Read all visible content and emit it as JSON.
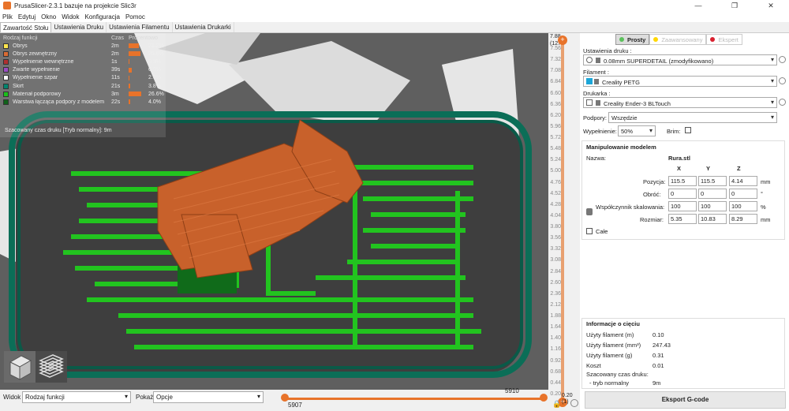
{
  "window": {
    "title": "PrusaSlicer-2.3.1 bazuje na projekcie Slic3r",
    "controls": [
      "—",
      "❐",
      "✕"
    ]
  },
  "menu": [
    "Plik",
    "Edytuj",
    "Okno",
    "Widok",
    "Konfiguracja",
    "Pomoc"
  ],
  "tabs": [
    "Zawartość Stołu",
    "Ustawienia Druku",
    "Ustawienia Filamentu",
    "Ustawienia Drukarki"
  ],
  "legend": {
    "headers": {
      "feature": "Rodzaj funkcji",
      "time": "Czas",
      "percent": "Procentowo"
    },
    "rows": [
      {
        "name": "Obrys",
        "time": "2m",
        "percent": "21.2%",
        "value": 21.2,
        "color": "#ffe64d"
      },
      {
        "name": "Obrys zewnętrzny",
        "time": "2m",
        "percent": "25.6%",
        "value": 25.6,
        "color": "#d96b33"
      },
      {
        "name": "Wypełnienie wewnętrzne",
        "time": "1s",
        "percent": "0.3%",
        "value": 0.3,
        "color": "#b03030"
      },
      {
        "name": "Zwarte wypełnienie",
        "time": "39s",
        "percent": "6.9%",
        "value": 6.9,
        "color": "#9a4dc4"
      },
      {
        "name": "Wypełnienie szpar",
        "time": "11s",
        "percent": "2.0%",
        "value": 2.0,
        "color": "#ffffff"
      },
      {
        "name": "Skirt",
        "time": "21s",
        "percent": "3.8%",
        "value": 3.8,
        "color": "#00856e"
      },
      {
        "name": "Materiał podporowy",
        "time": "3m",
        "percent": "26.6%",
        "value": 26.6,
        "color": "#1ac01a"
      },
      {
        "name": "Warstwa łącząca podpory z modelem",
        "time": "22s",
        "percent": "4.0%",
        "value": 4.0,
        "color": "#10621a"
      }
    ],
    "estimated": "Szacowany czas druku [Tryb normalny]:",
    "estimated_value": "9m"
  },
  "vslider": {
    "top_value": "7.88",
    "top_layer": "(127)",
    "bottom_value": "0.20",
    "bottom_layer": "(1)",
    "ticks": [
      "7.56",
      "7.32",
      "7.08",
      "6.84",
      "6.60",
      "6.36",
      "6.20",
      "5.96",
      "5.72",
      "5.48",
      "5.24",
      "5.00",
      "4.76",
      "4.52",
      "4.28",
      "4.04",
      "3.80",
      "3.56",
      "3.32",
      "3.08",
      "2.84",
      "2.60",
      "2.36",
      "2.12",
      "1.88",
      "1.64",
      "1.40",
      "1.16",
      "0.92",
      "0.68",
      "0.44",
      "0.20"
    ]
  },
  "bottom": {
    "view_label": "Widok",
    "view_value": "Rodzaj funkcji",
    "show_label": "Pokaż",
    "show_value": "Opcje",
    "hslider_right": "5910",
    "hslider_left": "5907"
  },
  "panel": {
    "modes": [
      {
        "label": "Prosty",
        "color": "#5cc15c",
        "active": true
      },
      {
        "label": "Zaawansowany",
        "color": "#ffd700",
        "active": false
      },
      {
        "label": "Ekspert",
        "color": "#d9202f",
        "active": false
      }
    ],
    "print_settings_label": "Ustawienia druku :",
    "print_settings_value": "0.08mm SUPERDETAIL (zmodyfikowano)",
    "filament_label": "Filament :",
    "filament_value": "Creality PETG",
    "printer_label": "Drukarka :",
    "printer_value": "Creality Ender-3 BLTouch",
    "supports_label": "Podpory:",
    "supports_value": "Wszędzie",
    "infill_label": "Wypełnienie:",
    "infill_value": "50%",
    "brim_label": "Brim:",
    "manip_title": "Manipulowanie modelem",
    "name_label": "Nazwa:",
    "name_value": "Rura.stl",
    "axes": [
      "X",
      "Y",
      "Z"
    ],
    "position_label": "Pozycja:",
    "position": [
      "115.5",
      "115.5",
      "4.14"
    ],
    "position_unit": "mm",
    "rotation_label": "Obróć:",
    "rotation": [
      "0",
      "0",
      "0"
    ],
    "rotation_unit": "°",
    "scale_label": "Współczynnik skalowania:",
    "scale": [
      "100",
      "100",
      "100"
    ],
    "scale_unit": "%",
    "size_label": "Rozmiar:",
    "size": [
      "5.35",
      "10.83",
      "8.29"
    ],
    "size_unit": "mm",
    "whole_label": "Całe",
    "slice_title": "Informacje o cięciu",
    "slice_rows": [
      {
        "label": "Użyty filament (m)",
        "value": "0.10"
      },
      {
        "label": "Użyty filament (mm³)",
        "value": "247.43"
      },
      {
        "label": "Użyty filament (g)",
        "value": "0.31"
      },
      {
        "label": "Koszt",
        "value": "0.01"
      }
    ],
    "est_time_label": "Szacowany czas druku:",
    "est_mode_label": "- tryb normalny",
    "est_mode_value": "9m",
    "export_label": "Eksport G-code"
  }
}
